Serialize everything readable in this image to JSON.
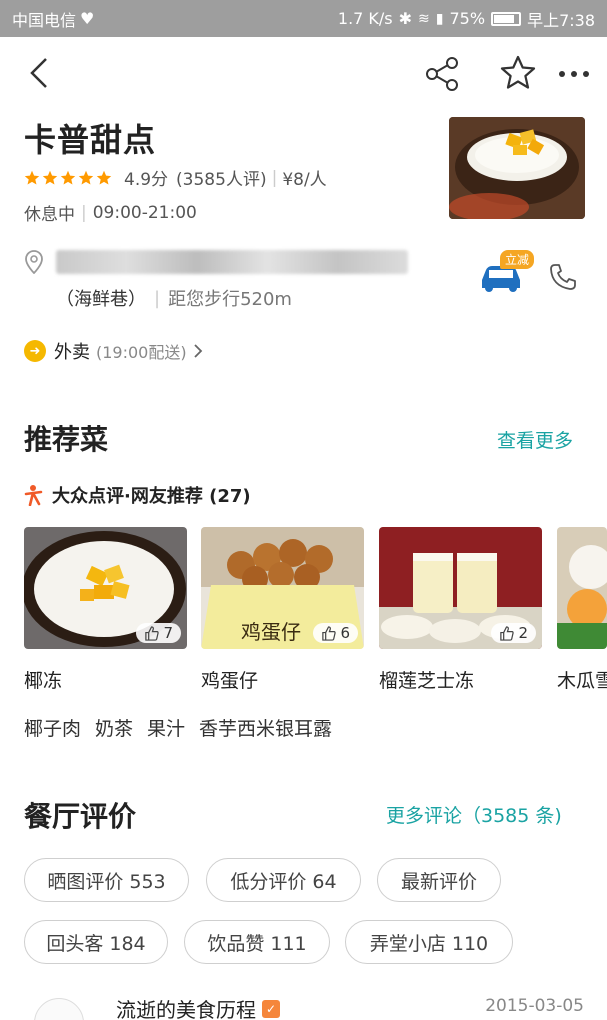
{
  "status_bar": {
    "carrier": "中国电信",
    "speed": "1.7 K/s",
    "network": "4G",
    "battery": "75%",
    "time": "早上7:38"
  },
  "nav": {
    "icons": [
      "back-icon",
      "share-icon",
      "star-icon",
      "more-icon"
    ]
  },
  "shop": {
    "name": "卡普甜点",
    "score": "4.9分",
    "reviews": "(3585人评)",
    "price": "¥8/人",
    "status": "休息中",
    "hours": "09:00-21:00",
    "area": "（海鲜巷）",
    "distance": "距您步行520m",
    "car_badge": "立减",
    "star_color": "#ff9a00"
  },
  "takeout": {
    "label": "外卖",
    "detail": "(19:00配送)"
  },
  "recommend": {
    "title": "推荐菜",
    "more": "查看更多",
    "source": "大众点评·网友推荐 (27)",
    "dishes": [
      {
        "name": "椰冻",
        "likes": "7"
      },
      {
        "name": "鸡蛋仔",
        "likes": "6",
        "package_text": "鸡蛋仔"
      },
      {
        "name": "榴莲芝士冻",
        "likes": "2"
      },
      {
        "name": "木瓜雪"
      }
    ],
    "tags": [
      "椰子肉",
      "奶茶",
      "果汁",
      "香芋西米银耳露"
    ]
  },
  "reviews_section": {
    "title": "餐厅评价",
    "more": "更多评论（3585 条)",
    "chips": [
      "晒图评价 553",
      "低分评价 64",
      "最新评价",
      "回头客 184",
      "饮品赞 111",
      "弄堂小店 110"
    ],
    "first_review": {
      "user": "流逝的美食历程",
      "date": "2015-03-05"
    }
  },
  "accent_color": "#1aa3a3"
}
